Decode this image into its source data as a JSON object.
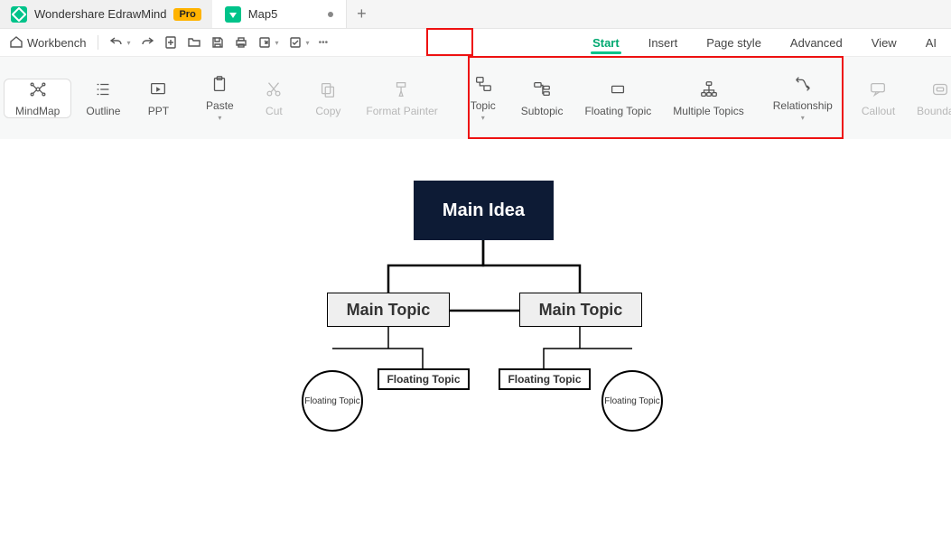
{
  "titlebar": {
    "app_name": "Wondershare EdrawMind",
    "pro_badge": "Pro",
    "doc_name": "Map5",
    "plus": "+"
  },
  "quick": {
    "workbench": "Workbench"
  },
  "menu": {
    "start": "Start",
    "insert": "Insert",
    "page_style": "Page style",
    "advanced": "Advanced",
    "view": "View",
    "ai": "AI"
  },
  "ribbon": {
    "mindmap": "MindMap",
    "outline": "Outline",
    "ppt": "PPT",
    "paste": "Paste",
    "cut": "Cut",
    "copy": "Copy",
    "format_painter": "Format Painter",
    "topic": "Topic",
    "subtopic": "Subtopic",
    "floating_topic": "Floating Topic",
    "multiple_topics": "Multiple Topics",
    "relationship": "Relationship",
    "callout": "Callout",
    "boundary": "Boundary"
  },
  "nodes": {
    "main_idea": "Main Idea",
    "main_topic_l": "Main Topic",
    "main_topic_r": "Main Topic",
    "float_rect_l": "Floating Topic",
    "float_rect_r": "Floating Topic",
    "float_circ_l": "Floating Topic",
    "float_circ_r": "Floating Topic"
  }
}
